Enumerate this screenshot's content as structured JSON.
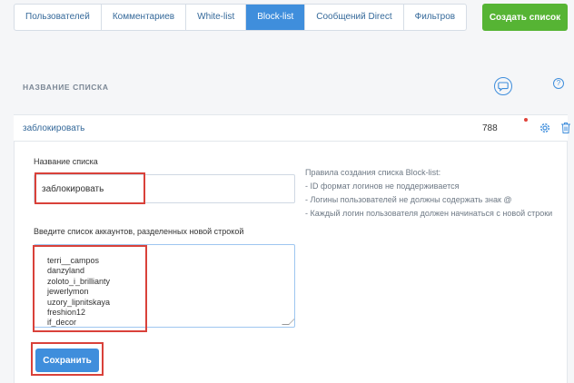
{
  "tabs": [
    {
      "label": "Пользователей",
      "active": false
    },
    {
      "label": "Комментариев",
      "active": false
    },
    {
      "label": "White-list",
      "active": false
    },
    {
      "label": "Block-list",
      "active": true
    },
    {
      "label": "Сообщений Direct",
      "active": false
    },
    {
      "label": "Фильтров",
      "active": false
    }
  ],
  "create_button": "Создать список",
  "section": {
    "title": "НАЗВАНИЕ СПИСКА",
    "help": "?"
  },
  "list_row": {
    "name": "заблокировать",
    "count": "788"
  },
  "form": {
    "name_label": "Название списка",
    "name_value": "заблокировать",
    "accounts_label": "Введите список аккаунтов, разделенных новой строкой",
    "accounts": [
      "terri__campos",
      "danzyland",
      "zoloto_i_brillianty",
      "jewerlymon",
      "uzory_lipnitskaya",
      "freshion12",
      "if_decor"
    ],
    "save_button": "Сохранить"
  },
  "rules": {
    "title": "Правила создания списка Block-list:",
    "items": [
      "- ID формат логинов не поддерживается",
      "- Логины пользователей не должны содержать знак @",
      "- Каждый логин пользователя должен начинаться с новой строки"
    ]
  },
  "colors": {
    "accent": "#3f8edc",
    "create": "#56b434",
    "highlight": "#d9413a"
  }
}
